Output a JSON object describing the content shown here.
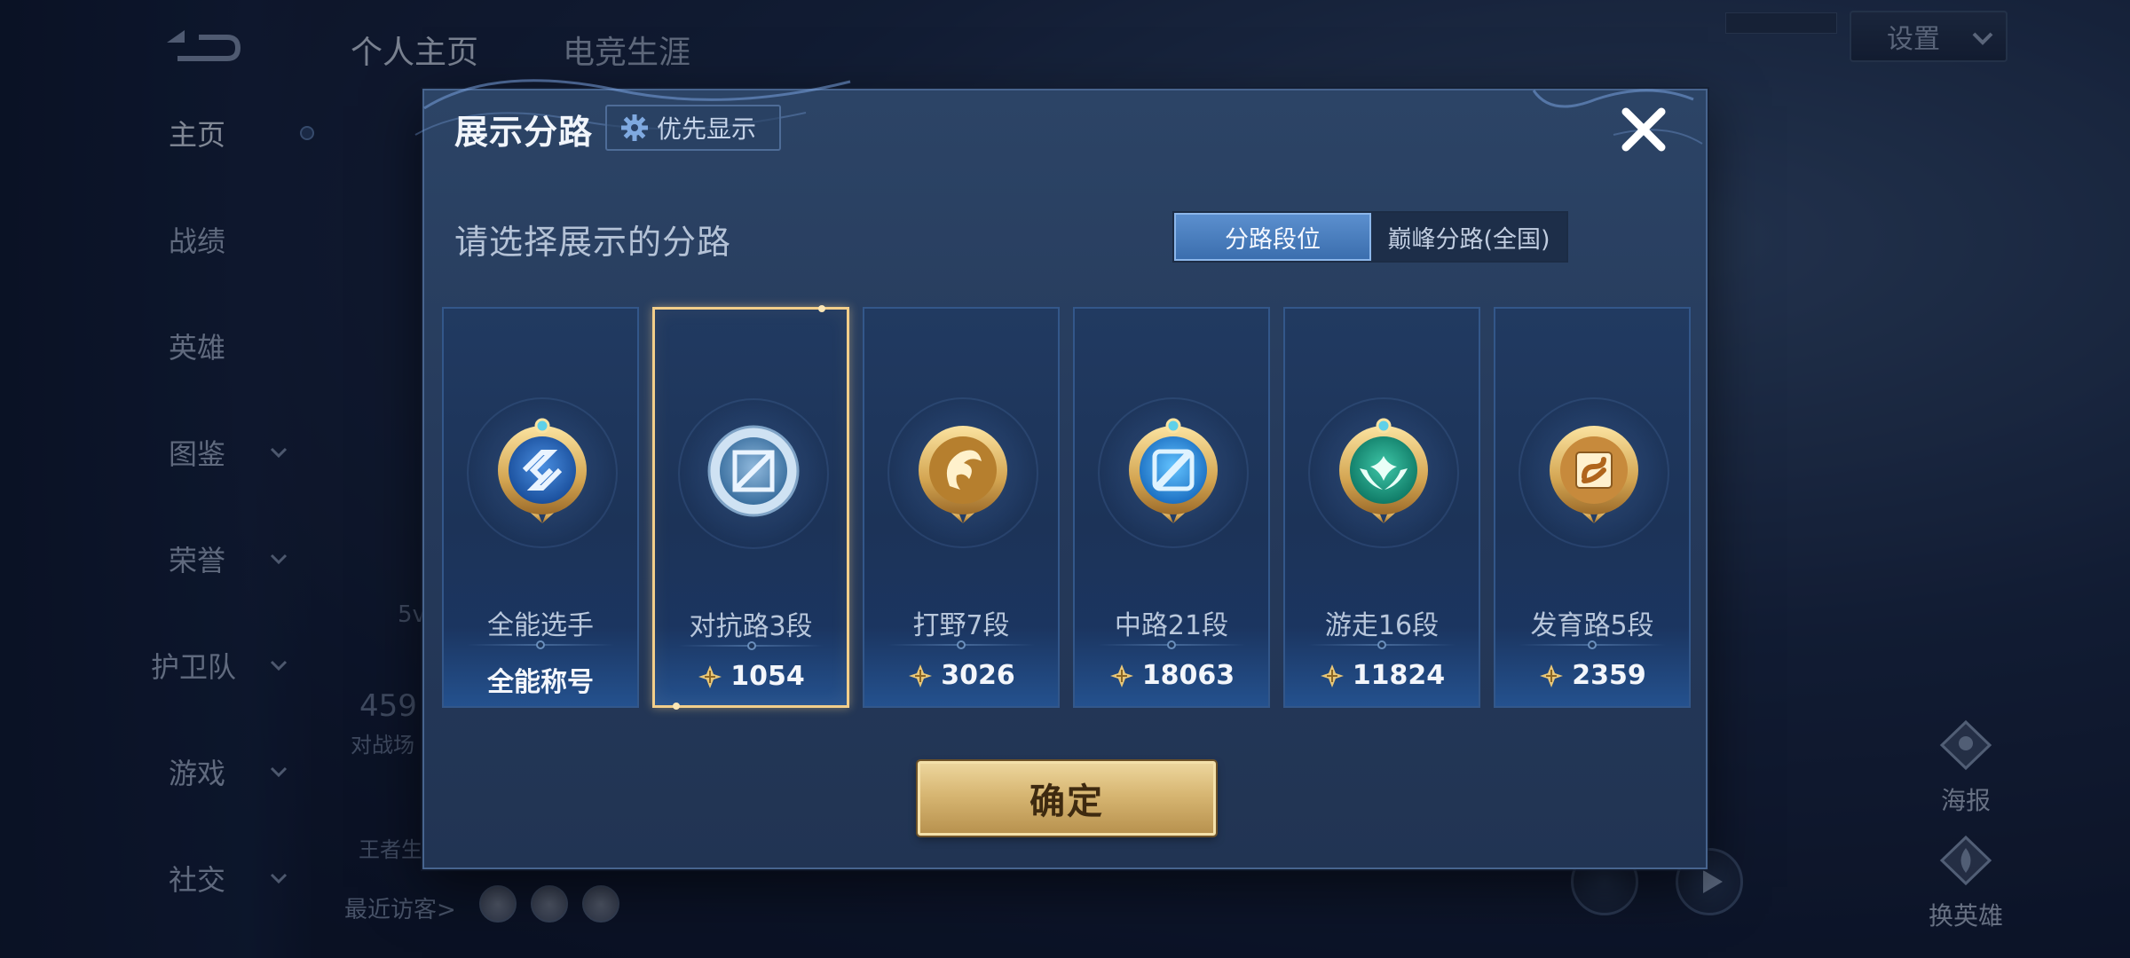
{
  "background": {
    "tabs": [
      "个人主页",
      "电竞生涯"
    ],
    "nav": [
      {
        "label": "主页",
        "active": true,
        "has_chevron": false
      },
      {
        "label": "战绩",
        "active": false,
        "has_chevron": false
      },
      {
        "label": "英雄",
        "active": false,
        "has_chevron": false
      },
      {
        "label": "图鉴",
        "active": false,
        "has_chevron": true
      },
      {
        "label": "荣誉",
        "active": false,
        "has_chevron": true
      },
      {
        "label": "护卫队",
        "active": false,
        "has_chevron": true
      },
      {
        "label": "游戏",
        "active": false,
        "has_chevron": true
      },
      {
        "label": "社交",
        "active": false,
        "has_chevron": true
      }
    ],
    "settings_label": "设置",
    "recent_visitors_label": "最近访客>",
    "faded": {
      "battles_value": "459",
      "battles_label": "对战场",
      "stat_5v": "5v",
      "king_label": "王者生"
    },
    "side_buttons": {
      "poster": "海报",
      "change_hero": "换英雄"
    }
  },
  "modal": {
    "title": "展示分路",
    "priority_label": "优先显示",
    "subtitle": "请选择展示的分路",
    "segments": [
      "分路段位",
      "巅峰分路(全国)"
    ],
    "active_segment": 0,
    "confirm_label": "确定"
  },
  "lanes": [
    {
      "name": "全能选手",
      "value": "全能称号",
      "emblem": "all-round-emblem-icon",
      "selected": false,
      "has_points_icon": false
    },
    {
      "name": "对抗路3段",
      "value": "1054",
      "emblem": "clash-lane-emblem-icon",
      "selected": true,
      "has_points_icon": true
    },
    {
      "name": "打野7段",
      "value": "3026",
      "emblem": "jungle-emblem-icon",
      "selected": false,
      "has_points_icon": true
    },
    {
      "name": "中路21段",
      "value": "18063",
      "emblem": "mid-lane-emblem-icon",
      "selected": false,
      "has_points_icon": true
    },
    {
      "name": "游走16段",
      "value": "11824",
      "emblem": "roam-emblem-icon",
      "selected": false,
      "has_points_icon": true
    },
    {
      "name": "发育路5段",
      "value": "2359",
      "emblem": "farm-lane-emblem-icon",
      "selected": false,
      "has_points_icon": true
    }
  ],
  "colors": {
    "modal_bg": "#25395a",
    "selected_border": "#f2ce8a",
    "confirm_gold": "#d7b672",
    "segment_active": "#4a7fc0"
  }
}
